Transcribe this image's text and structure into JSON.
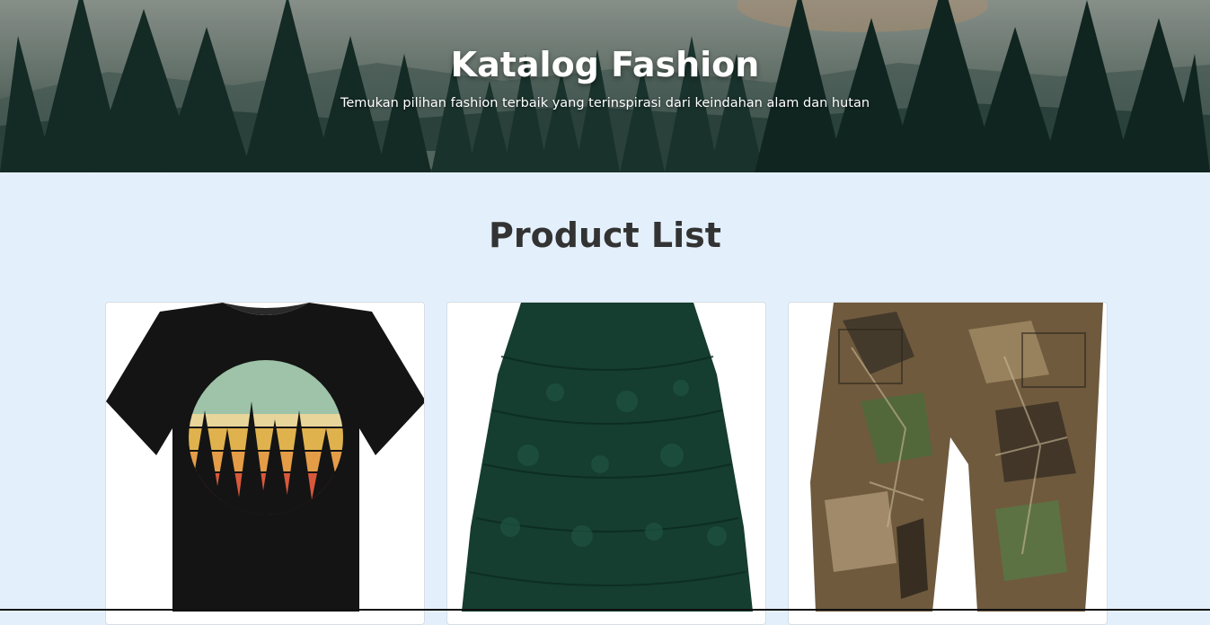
{
  "hero": {
    "title": "Katalog Fashion",
    "subtitle": "Temukan pilihan fashion terbaik yang terinspirasi dari keindahan alam dan hutan"
  },
  "main": {
    "section_title": "Product List",
    "products": [
      {
        "image": "forest-t-shirt"
      },
      {
        "image": "green-lace-dress"
      },
      {
        "image": "camo-cargo-pants"
      }
    ]
  },
  "colors": {
    "page_background": "#e3f0fc",
    "hero_text": "#ffffff",
    "heading_text": "#333333",
    "card_background": "#ffffff"
  }
}
